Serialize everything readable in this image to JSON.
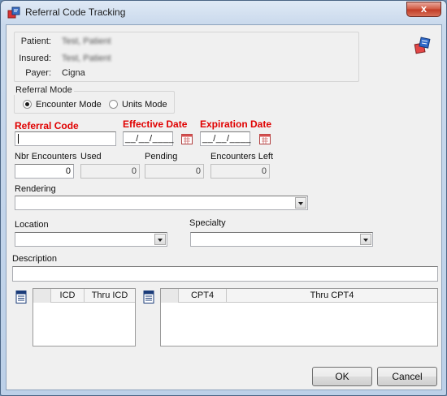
{
  "window": {
    "title": "Referral Code Tracking",
    "close_glyph": "x"
  },
  "patient_info": {
    "patient_label": "Patient:",
    "patient_value": "Test, Patient",
    "insured_label": "Insured:",
    "insured_value": "Test, Patient",
    "payer_label": "Payer:",
    "payer_value": "Cigna"
  },
  "referral_mode": {
    "legend": "Referral Mode",
    "options": [
      {
        "label": "Encounter Mode",
        "selected": true
      },
      {
        "label": "Units Mode",
        "selected": false
      }
    ]
  },
  "fields": {
    "referral_code_label": "Referral Code",
    "referral_code_value": "",
    "effective_date_label": "Effective Date",
    "effective_date_mask": "__/__/____",
    "expiration_date_label": "Expiration Date",
    "expiration_date_mask": "__/__/____"
  },
  "counts": {
    "nbr_encounters_label": "Nbr Encounters",
    "nbr_encounters_value": "0",
    "used_label": "Used",
    "used_value": "0",
    "pending_label": "Pending",
    "pending_value": "0",
    "encounters_left_label": "Encounters Left",
    "encounters_left_value": "0"
  },
  "dropdowns": {
    "rendering_label": "Rendering",
    "rendering_value": "",
    "location_label": "Location",
    "location_value": "",
    "specialty_label": "Specialty",
    "specialty_value": ""
  },
  "description": {
    "label": "Description",
    "value": ""
  },
  "icd_grid": {
    "columns": [
      "ICD",
      "Thru ICD"
    ],
    "rows": []
  },
  "cpt_grid": {
    "columns": [
      "CPT4",
      "Thru CPT4"
    ],
    "rows": []
  },
  "buttons": {
    "ok": "OK",
    "cancel": "Cancel"
  },
  "colors": {
    "required_label": "#e00000",
    "close_button": "#c13a25"
  },
  "icons": {
    "app": "referral-app-icon",
    "corner_logo": "referral-logo-icon",
    "calendar": "calendar-icon",
    "grid_edit": "grid-edit-icon"
  }
}
